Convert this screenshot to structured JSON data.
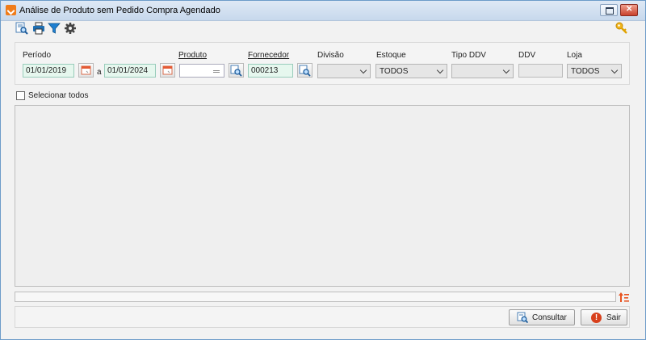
{
  "window": {
    "title": "Análise de Produto sem Pedido Compra Agendado"
  },
  "toolbar": {
    "icons": [
      "search-icon",
      "printer-icon",
      "filter-icon",
      "gear-icon",
      "key-icon"
    ]
  },
  "filters": {
    "periodo": {
      "label": "Período",
      "from": "01/01/2019",
      "separator": "a",
      "to": "01/01/2024"
    },
    "produto": {
      "label": "Produto",
      "value": ""
    },
    "fornecedor": {
      "label": "Fornecedor",
      "value": "000213"
    },
    "divisao": {
      "label": "Divisão",
      "value": ""
    },
    "estoque": {
      "label": "Estoque",
      "value": "TODOS"
    },
    "tipo_ddv": {
      "label": "Tipo DDV",
      "value": ""
    },
    "ddv": {
      "label": "DDV",
      "value": ""
    },
    "loja": {
      "label": "Loja",
      "value": "TODOS"
    }
  },
  "select_all": {
    "label": "Selecionar todos",
    "checked": false
  },
  "buttons": {
    "consultar": "Consultar",
    "sair": "Sair"
  },
  "colors": {
    "accent": "#f07c1a",
    "titlebar": "#c7d8ec",
    "field_highlight": "#e6f7ee",
    "exit": "#d8401c"
  }
}
